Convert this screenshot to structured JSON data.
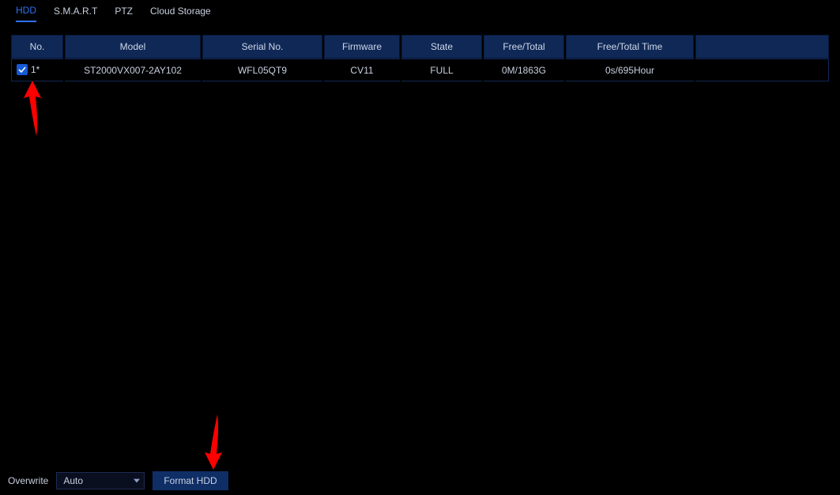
{
  "tabs": {
    "hdd": "HDD",
    "smart": "S.M.A.R.T",
    "ptz": "PTZ",
    "cloud": "Cloud Storage"
  },
  "table": {
    "headers": {
      "no": "No.",
      "model": "Model",
      "serial": "Serial No.",
      "firmware": "Firmware",
      "state": "State",
      "freetotal": "Free/Total",
      "freetotaltime": "Free/Total Time",
      "blank": ""
    },
    "rows": [
      {
        "checked": true,
        "no": "1*",
        "model": "ST2000VX007-2AY102",
        "serial": "WFL05QT9",
        "firmware": "CV11",
        "state": "FULL",
        "freetotal": "0M/1863G",
        "freetotaltime": "0s/695Hour"
      }
    ]
  },
  "overwrite": {
    "label": "Overwrite",
    "value": "Auto"
  },
  "buttons": {
    "format": "Format HDD"
  }
}
